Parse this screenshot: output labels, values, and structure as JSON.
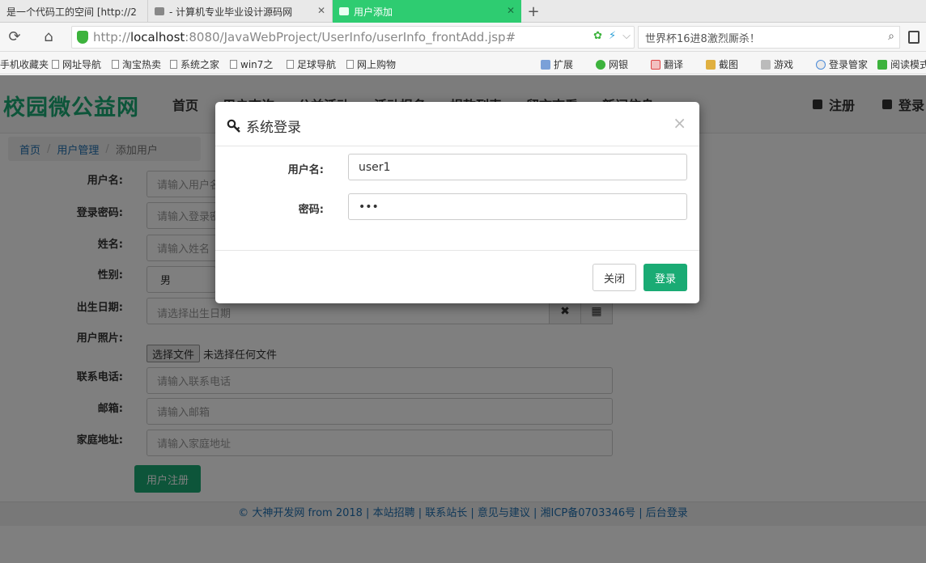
{
  "browser": {
    "tabs": [
      {
        "label": "是一个代码工的空间 [http://2"
      },
      {
        "label": "- 计算机专业毕业设计源码网"
      },
      {
        "label": "用户添加"
      }
    ],
    "newtab": "+",
    "url": {
      "scheme": "http://",
      "host": "localhost",
      "rest": ":8080/JavaWebProject/UserInfo/userInfo_frontAdd.jsp#"
    },
    "search_text": "世界杯16进8激烈厮杀！",
    "bookmarks": [
      "手机收藏夹",
      "网址导航",
      "淘宝热卖",
      "系统之家",
      "win7之",
      "足球导航",
      "网上购物"
    ],
    "extensions": [
      "扩展",
      "网银",
      "翻译",
      "截图",
      "游戏",
      "登录管家",
      "阅读模式"
    ]
  },
  "site": {
    "brand": "校园微公益网",
    "nav": [
      "首页",
      "用户查询",
      "公益活动",
      "活动报名",
      "捐款列表",
      "留言查看",
      "新闻信息"
    ],
    "nav_right": {
      "register": "注册",
      "login": "登录"
    }
  },
  "breadcrumb": {
    "home": "首页",
    "section": "用户管理",
    "current": "添加用户"
  },
  "form": {
    "username_label": "用户名:",
    "username_placeholder": "请输入用户名",
    "password_label": "登录密码:",
    "password_placeholder": "请输入登录密码",
    "name_label": "姓名:",
    "name_placeholder": "请输入姓名",
    "gender_label": "性别:",
    "gender_value": "男",
    "birthday_label": "出生日期:",
    "birthday_placeholder": "请选择出生日期",
    "photo_label": "用户照片:",
    "file_button": "选择文件",
    "file_status": "未选择任何文件",
    "phone_label": "联系电话:",
    "phone_placeholder": "请输入联系电话",
    "email_label": "邮箱:",
    "email_placeholder": "请输入邮箱",
    "address_label": "家庭地址:",
    "address_placeholder": "请输入家庭地址",
    "submit": "用户注册"
  },
  "footer": {
    "text": "© 大神开发网 from 2018 | 本站招聘 | 联系站长 | 意见与建议 | 湘ICP备0703346号 | 后台登录"
  },
  "modal": {
    "title": "系统登录",
    "username_label": "用户名:",
    "username_value": "user1",
    "password_label": "密码:",
    "password_value": "•••",
    "close_button": "关闭",
    "login_button": "登录"
  },
  "colors": {
    "accent": "#1aab74",
    "link": "#1e6fb0",
    "active_tab": "#2ecc71"
  }
}
